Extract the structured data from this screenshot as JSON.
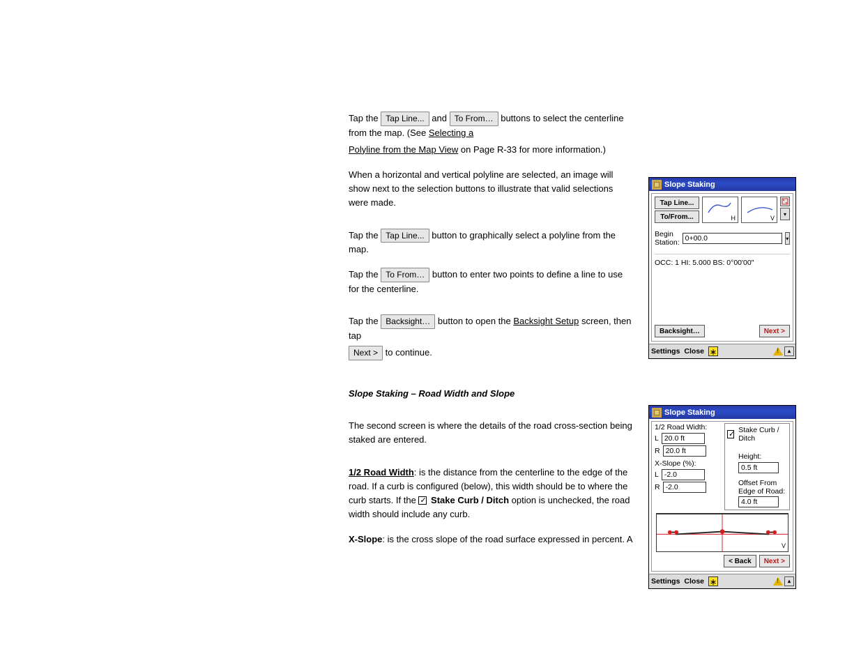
{
  "main": {
    "p1_a": "Tap the ",
    "p1_btn1": "Tap Line...",
    "p1_mid": " and ",
    "p1_btn2": "To From…",
    "p1_tail": " buttons to select the centerline from the map. (See ",
    "p1_link": "Selecting a",
    "p1_link_line2": "Polyline from the Map View",
    "p1_after_link": " on Page R-33 for more information.)",
    "p2": "When a horizontal and vertical polyline are selected, an image will show next to the selection buttons to illustrate that valid selections were made.",
    "p3_a": "Tap the ",
    "p3_btn": "Tap Line...",
    "p3_b": " button to graphically select a polyline from the map.",
    "p4_a": "Tap the ",
    "p4_btn": "To From…",
    "p4_b": " button to enter two points to define a line to use for the centerline.",
    "p5_a": "Tap the ",
    "p5_btn1": "Backsight…",
    "p5_mid": " button to open the ",
    "p5_link": "Backsight Setup",
    "p5_after": " screen, then tap ",
    "p5_btn2": "Next >",
    "p5_tail": " to continue.",
    "heading": "Slope Staking – Road Width and Slope",
    "p6": "The second screen is where the details of the road cross-section being staked are entered.",
    "p7_lead": "1/2 Road Width",
    "p7_a": ": is the distance from the centerline to the edge of the road. If a curb is configured (below), this width should be to where the curb starts. If the ",
    "p7_chk_label": " Stake Curb / Ditch",
    "p7_b": " option is unchecked, the road width should include any curb.",
    "p8_lead": "X-Slope",
    "p8_a": ": is the cross slope of the road surface expressed in percent. A"
  },
  "dev1": {
    "title": "Slope Staking",
    "tapline": "Tap Line...",
    "tofrom": "To/From...",
    "tag_h": "H",
    "tag_v": "V",
    "begin_label": "Begin Station:",
    "begin_value": "0+00.0",
    "occ": "OCC: 1  HI: 5.000  BS: 0°00'00\"",
    "backsight": "Backsight…",
    "next": "Next >",
    "settings": "Settings",
    "close": "Close"
  },
  "dev2": {
    "title": "Slope Staking",
    "label_halfwidth": "1/2 Road Width:",
    "L": "L",
    "R": "R",
    "half_l": "20.0 ft",
    "half_r": "20.0 ft",
    "xslope_label": "X-Slope (%):",
    "xs_l": "-2.0",
    "xs_r": "-2.0",
    "stake_label": "Stake Curb / Ditch",
    "height_label": "Height:",
    "height_val": "0.5 ft",
    "offset_label1": "Offset From",
    "offset_label2": "Edge of Road:",
    "offset_val": "4.0 ft",
    "back": "< Back",
    "next": "Next >",
    "settings": "Settings",
    "close": "Close",
    "vtag": "V"
  }
}
